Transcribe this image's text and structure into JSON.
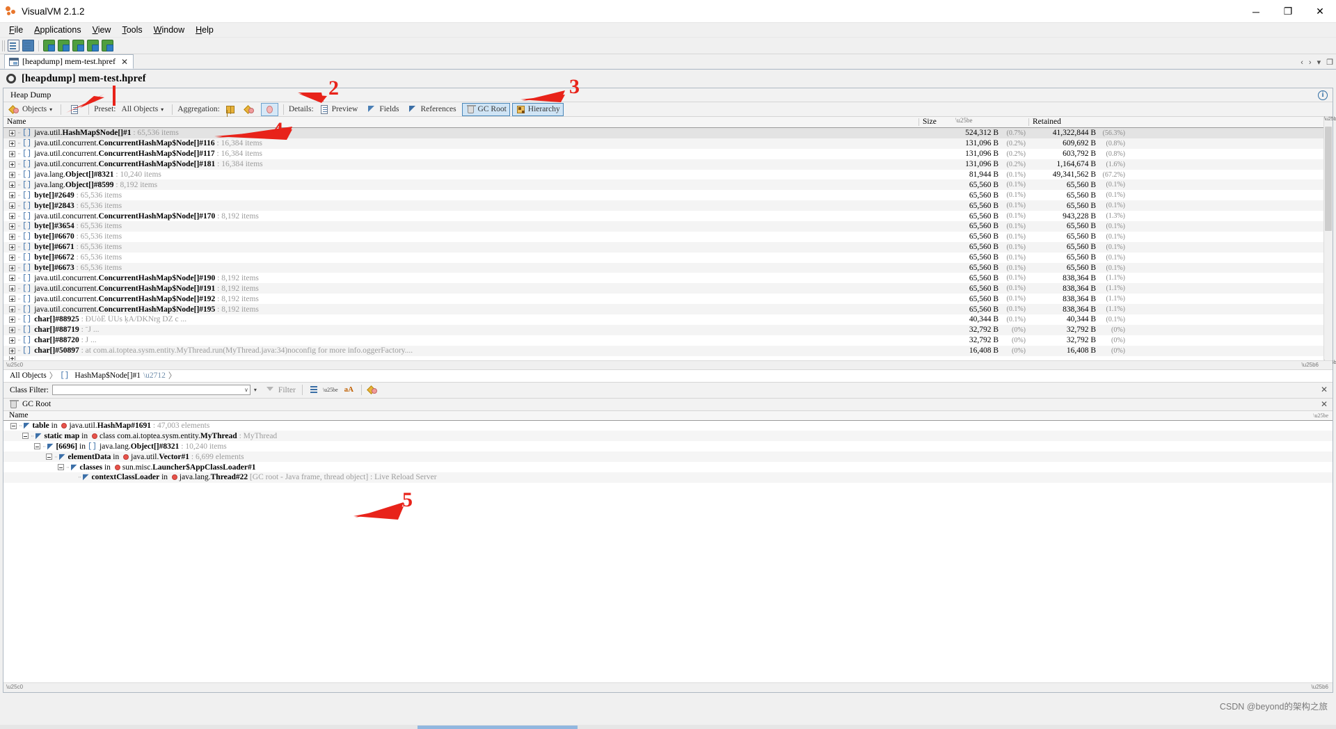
{
  "window": {
    "title": "VisualVM 2.1.2",
    "icon": "visualvm-icon",
    "controls": {
      "minimize": "─",
      "maximize": "❐",
      "close": "✕"
    }
  },
  "menubar": [
    {
      "label": "File",
      "mnemonic": "F"
    },
    {
      "label": "Applications",
      "mnemonic": "A"
    },
    {
      "label": "View",
      "mnemonic": "V"
    },
    {
      "label": "Tools",
      "mnemonic": "T"
    },
    {
      "label": "Window",
      "mnemonic": "W"
    },
    {
      "label": "Help",
      "mnemonic": "H"
    }
  ],
  "main_toolbar": [
    {
      "name": "open-file-button",
      "icon": "open-document-icon"
    },
    {
      "name": "save-button",
      "icon": "save-disk-icon"
    },
    {
      "name": "add-jmx-connection-button",
      "icon": "add-connection-icon"
    },
    {
      "name": "add-remote-host-button",
      "icon": "add-host-icon"
    },
    {
      "name": "add-application-button",
      "icon": "add-application-icon"
    },
    {
      "name": "add-snapshot-button",
      "icon": "add-snapshot-icon"
    },
    {
      "name": "add-profile-button",
      "icon": "add-profile-icon"
    }
  ],
  "document_tab": {
    "label": "[heapdump] mem-test.hpref",
    "icon": "heapdump-icon",
    "close": "✕"
  },
  "tabstrip_controls": {
    "left": "‹",
    "right": "›",
    "dropdown": "▾",
    "maximize": "❐"
  },
  "document_header": {
    "title": "[heapdump] mem-test.hpref",
    "icon": "loading-ring-icon"
  },
  "subtabs": [
    {
      "label": "Heap Dump",
      "selected": true
    }
  ],
  "analysis_toolbar": {
    "objects_button": {
      "label": "Objects",
      "caret": "▾",
      "icon": "objects-icon"
    },
    "compare_button": {
      "icon": "compare-snapshot-icon"
    },
    "preset_label": "Preset:",
    "preset_value": "All Objects",
    "preset_caret": "▾",
    "aggregation_label": "Aggregation:",
    "aggregation_buttons": [
      {
        "name": "aggregation-classes-button",
        "icon": "classes-grid-icon",
        "active": false
      },
      {
        "name": "aggregation-packages-button",
        "icon": "packages-icon",
        "active": false
      },
      {
        "name": "aggregation-instances-button",
        "icon": "instances-icon",
        "active": true
      }
    ],
    "details_label": "Details:",
    "details_buttons": [
      {
        "name": "details-preview-button",
        "label": "Preview",
        "icon": "preview-page-icon"
      },
      {
        "name": "details-fields-button",
        "label": "Fields",
        "icon": "fields-arrow-icon"
      },
      {
        "name": "details-references-button",
        "label": "References",
        "icon": "references-arrow-icon"
      },
      {
        "name": "details-gc-root-button",
        "label": "GC Root",
        "icon": "trash-bin-icon",
        "selected": true
      },
      {
        "name": "details-hierarchy-button",
        "label": "Hierarchy",
        "icon": "hierarchy-icon",
        "selected": true
      }
    ],
    "info_button": "i"
  },
  "table": {
    "columns": [
      {
        "key": "name",
        "label": "Name"
      },
      {
        "key": "size",
        "label": "Size"
      },
      {
        "key": "retained",
        "label": "Retained"
      }
    ],
    "rows": [
      {
        "pkg": "java.util.",
        "cls": "HashMap$Node[]#1",
        "detail": ": 65,536 items",
        "size": "524,312 B",
        "sizep": "(0.7%)",
        "ret": "41,322,844 B",
        "retp": "(56.3%)",
        "selected": true
      },
      {
        "pkg": "java.util.concurrent.",
        "cls": "ConcurrentHashMap$Node[]#116",
        "detail": ": 16,384 items",
        "size": "131,096 B",
        "sizep": "(0.2%)",
        "ret": "609,692 B",
        "retp": "(0.8%)"
      },
      {
        "pkg": "java.util.concurrent.",
        "cls": "ConcurrentHashMap$Node[]#117",
        "detail": ": 16,384 items",
        "size": "131,096 B",
        "sizep": "(0.2%)",
        "ret": "603,792 B",
        "retp": "(0.8%)"
      },
      {
        "pkg": "java.util.concurrent.",
        "cls": "ConcurrentHashMap$Node[]#181",
        "detail": ": 16,384 items",
        "size": "131,096 B",
        "sizep": "(0.2%)",
        "ret": "1,164,674 B",
        "retp": "(1.6%)"
      },
      {
        "pkg": "java.lang.",
        "cls": "Object[]#8321",
        "detail": ": 10,240 items",
        "size": "81,944 B",
        "sizep": "(0.1%)",
        "ret": "49,341,562 B",
        "retp": "(67.2%)"
      },
      {
        "pkg": "java.lang.",
        "cls": "Object[]#8599",
        "detail": ": 8,192 items",
        "size": "65,560 B",
        "sizep": "(0.1%)",
        "ret": "65,560 B",
        "retp": "(0.1%)"
      },
      {
        "pkg": "",
        "cls": "byte[]#2649",
        "detail": ": 65,536 items",
        "size": "65,560 B",
        "sizep": "(0.1%)",
        "ret": "65,560 B",
        "retp": "(0.1%)"
      },
      {
        "pkg": "",
        "cls": "byte[]#2843",
        "detail": ": 65,536 items",
        "size": "65,560 B",
        "sizep": "(0.1%)",
        "ret": "65,560 B",
        "retp": "(0.1%)"
      },
      {
        "pkg": "java.util.concurrent.",
        "cls": "ConcurrentHashMap$Node[]#170",
        "detail": ": 8,192 items",
        "size": "65,560 B",
        "sizep": "(0.1%)",
        "ret": "943,228 B",
        "retp": "(1.3%)"
      },
      {
        "pkg": "",
        "cls": "byte[]#3654",
        "detail": ": 65,536 items",
        "size": "65,560 B",
        "sizep": "(0.1%)",
        "ret": "65,560 B",
        "retp": "(0.1%)"
      },
      {
        "pkg": "",
        "cls": "byte[]#6670",
        "detail": ": 65,536 items",
        "size": "65,560 B",
        "sizep": "(0.1%)",
        "ret": "65,560 B",
        "retp": "(0.1%)"
      },
      {
        "pkg": "",
        "cls": "byte[]#6671",
        "detail": ": 65,536 items",
        "size": "65,560 B",
        "sizep": "(0.1%)",
        "ret": "65,560 B",
        "retp": "(0.1%)"
      },
      {
        "pkg": "",
        "cls": "byte[]#6672",
        "detail": ": 65,536 items",
        "size": "65,560 B",
        "sizep": "(0.1%)",
        "ret": "65,560 B",
        "retp": "(0.1%)"
      },
      {
        "pkg": "",
        "cls": "byte[]#6673",
        "detail": ": 65,536 items",
        "size": "65,560 B",
        "sizep": "(0.1%)",
        "ret": "65,560 B",
        "retp": "(0.1%)"
      },
      {
        "pkg": "java.util.concurrent.",
        "cls": "ConcurrentHashMap$Node[]#190",
        "detail": ": 8,192 items",
        "size": "65,560 B",
        "sizep": "(0.1%)",
        "ret": "838,364 B",
        "retp": "(1.1%)"
      },
      {
        "pkg": "java.util.concurrent.",
        "cls": "ConcurrentHashMap$Node[]#191",
        "detail": ": 8,192 items",
        "size": "65,560 B",
        "sizep": "(0.1%)",
        "ret": "838,364 B",
        "retp": "(1.1%)"
      },
      {
        "pkg": "java.util.concurrent.",
        "cls": "ConcurrentHashMap$Node[]#192",
        "detail": ": 8,192 items",
        "size": "65,560 B",
        "sizep": "(0.1%)",
        "ret": "838,364 B",
        "retp": "(1.1%)"
      },
      {
        "pkg": "java.util.concurrent.",
        "cls": "ConcurrentHashMap$Node[]#195",
        "detail": ": 8,192 items",
        "size": "65,560 B",
        "sizep": "(0.1%)",
        "ret": "838,364 B",
        "retp": "(1.1%)"
      },
      {
        "pkg": "",
        "cls": "char[]#88925",
        "detail": ":      ÐUòÊ    ÛUs    ķA/DKNrg       DZ   c    ...",
        "size": "40,344 B",
        "sizep": "(0.1%)",
        "ret": "40,344 B",
        "retp": "(0.1%)"
      },
      {
        "pkg": "",
        "cls": "char[]#88719",
        "detail": ":       ˉJ          ...",
        "size": "32,792 B",
        "sizep": "(0%)",
        "ret": "32,792 B",
        "retp": "(0%)"
      },
      {
        "pkg": "",
        "cls": "char[]#88720",
        "detail": ":       J          ...",
        "size": "32,792 B",
        "sizep": "(0%)",
        "ret": "32,792 B",
        "retp": "(0%)"
      },
      {
        "pkg": "",
        "cls": "char[]#50897",
        "detail": ": at com.ai.toptea.sysm.entity.MyThread.run(MyThread.java:34)noconfig for more info.oggerFactory....",
        "size": "16,408 B",
        "sizep": "(0%)",
        "ret": "16,408 B",
        "retp": "(0%)"
      }
    ]
  },
  "breadcrumb": {
    "root": "All Objects",
    "sep": "〉",
    "node": "HashMap$Node[]#1",
    "pin_icon": "pin-icon",
    "trailing_sep": "〉"
  },
  "class_filter": {
    "label": "Class Filter:",
    "value": "",
    "placeholder": "",
    "combo_caret": "∨",
    "dropdown_caret": "▾",
    "filter_button": "Filter",
    "filter_icon": "funnel-icon",
    "view_button_icon": "list-view-icon",
    "font_button_icon": "font-size-icon",
    "color_button_icon": "color-icon",
    "close": "✕"
  },
  "gc_root_panel": {
    "title": "GC Root",
    "icon": "trash-bin-icon",
    "close": "✕",
    "column": "Name",
    "rows": [
      {
        "indent": 0,
        "expander": "minus",
        "field": "table",
        "in": "in",
        "dot": true,
        "pkg": "java.util.",
        "cls": "HashMap#1691",
        "detail": ": 47,003 elements",
        "italic": ""
      },
      {
        "indent": 1,
        "expander": "minus",
        "field": "static map",
        "in": "in",
        "dot": true,
        "pkg": "class com.ai.toptea.sysm.entity.",
        "cls": "MyThread",
        "detail": ":",
        "italic": "MyThread"
      },
      {
        "indent": 2,
        "expander": "minus",
        "field": "[6696]",
        "in": "in",
        "array": true,
        "pkg": "java.lang.",
        "cls": "Object[]#8321",
        "detail": ": 10,240 items",
        "italic": ""
      },
      {
        "indent": 3,
        "expander": "minus",
        "field": "elementData",
        "in": "in",
        "dot": true,
        "pkg": "java.util.",
        "cls": "Vector#1",
        "detail": ": 6,699 elements",
        "italic": ""
      },
      {
        "indent": 4,
        "expander": "minus",
        "field": "classes",
        "in": "in",
        "dot": true,
        "pkg": "sun.misc.",
        "cls": "Launcher$AppClassLoader#1",
        "detail": "",
        "italic": ""
      },
      {
        "indent": 5,
        "expander": "none",
        "field": "contextClassLoader",
        "in": "in",
        "dot": true,
        "pkg": "java.lang.",
        "cls": "Thread#22",
        "detail": "[GC root - Java frame, thread object]",
        "italic": ": Live Reload Server"
      }
    ]
  },
  "annotations": [
    {
      "number": "1",
      "kind": "vertical-line"
    },
    {
      "number": "2",
      "kind": "arrow"
    },
    {
      "number": "3",
      "kind": "arrow"
    },
    {
      "number": "4",
      "kind": "arrow"
    },
    {
      "number": "5",
      "kind": "arrow"
    }
  ],
  "watermark": "CSDN @beyond的架构之旅",
  "colors": {
    "annotation_red": "#e8231a",
    "selection_blue": "#cfe4f5",
    "bold_text": "#000000",
    "detail_gray": "#9c9c9c"
  }
}
